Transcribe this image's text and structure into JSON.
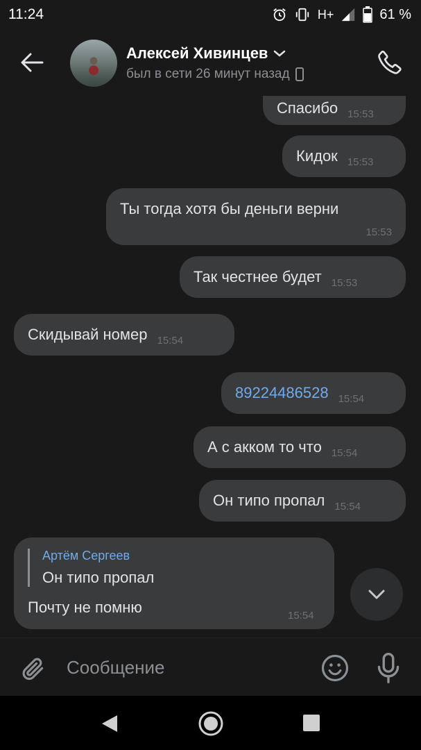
{
  "statusbar": {
    "time": "11:24",
    "network": "H+",
    "battery": "61 %",
    "icons": [
      "alarm-icon",
      "vibrate-icon",
      "signal-icon",
      "battery-icon"
    ]
  },
  "header": {
    "contact_name": "Алексей Хивинцев",
    "contact_status": "был в сети 26 минут назад",
    "icons": [
      "back-arrow-icon",
      "chevron-down-icon",
      "mobile-device-icon",
      "phone-icon"
    ]
  },
  "messages": [
    {
      "text": "Спасибо",
      "time": "15:53",
      "direction": "out"
    },
    {
      "text": "Кидок",
      "time": "15:53",
      "direction": "out"
    },
    {
      "text": "Ты тогда хотя бы деньги верни",
      "time": "15:53",
      "direction": "out"
    },
    {
      "text": "Так честнее будет",
      "time": "15:53",
      "direction": "out"
    },
    {
      "text": "Скидывай номер",
      "time": "15:54",
      "direction": "in"
    },
    {
      "text": "89224486528",
      "time": "15:54",
      "direction": "out",
      "is_link": true
    },
    {
      "text": "А с акком то что",
      "time": "15:54",
      "direction": "out"
    },
    {
      "text": "Он типо пропал",
      "time": "15:54",
      "direction": "out"
    }
  ],
  "reply_message": {
    "quote_author": "Артём Сергеев",
    "quote_text": "Он типо пропал",
    "text": "Почту не помню",
    "time": "15:54",
    "direction": "in"
  },
  "composer": {
    "placeholder": "Сообщение",
    "icons": [
      "paperclip-icon",
      "emoji-icon",
      "microphone-icon"
    ]
  },
  "colors": {
    "background": "#19191a",
    "bubble": "#3a3b3d",
    "link": "#71aaeb",
    "secondary_text": "#8c8f94"
  }
}
